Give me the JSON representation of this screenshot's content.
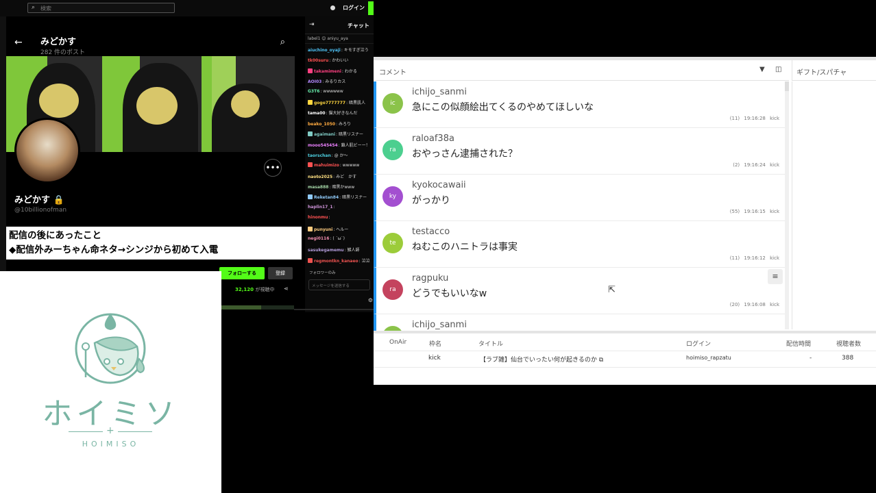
{
  "stream": {
    "search_placeholder": "検索",
    "login": "ログイン",
    "chat_title": "チャット",
    "pinned": "label1 😊 aniyu_aya",
    "follow_button": "フォローする",
    "subscribe_button": "登録",
    "viewers_count": "32,120",
    "viewers_label": "が視聴中",
    "progress_fraction": 0.55,
    "followers_label": "フォロワーのみ",
    "message_placeholder": "メッセージを送信する"
  },
  "profile": {
    "header_name": "みどかす",
    "post_count": "282 件のポスト",
    "display_name": "みどかす 🔒",
    "handle": "@10billionofman"
  },
  "caption": {
    "line1": "配信の後にあったこと",
    "line2": "◆配信外みーちゃん命ネタ→シンジから初めて入電"
  },
  "kick_chat": [
    {
      "user": "aiuchino_oyaji",
      "text": ": キモすぎ泣う",
      "color": "#4fc3f7"
    },
    {
      "user": "tk00suru",
      "text": ": かわいい",
      "color": "#ff5252"
    },
    {
      "user": "takamimeni",
      "text": ": わかる",
      "color": "#ff4081"
    },
    {
      "user": "AOI03",
      "text": ": みるりカス",
      "color": "#b388ff"
    },
    {
      "user": "G3T6",
      "text": ": wwwwww",
      "color": "#69f0ae"
    },
    {
      "user": "gogo7777777",
      "text": ": 暗黒肌人",
      "color": "#ffd740"
    },
    {
      "user": "tama00",
      "text": ": 猫大好きなんだ",
      "color": "#ffffff"
    },
    {
      "user": "beako_1050",
      "text": ": みろり",
      "color": "#ffab40"
    },
    {
      "user": "agaimani",
      "text": ": 暗黒リスナー",
      "color": "#80cbc4"
    },
    {
      "user": "mooo545454",
      "text": ": 鎖人肌ビーー！",
      "color": "#ea80fc"
    },
    {
      "user": "taorschan",
      "text": ": @ か〜",
      "color": "#4dd0e1"
    },
    {
      "user": "mahuimizo",
      "text": ": wwwww",
      "color": "#ff5252"
    },
    {
      "user": "naoto2025",
      "text": ": みど　かす",
      "color": "#ffe082"
    },
    {
      "user": "masa888",
      "text": ": 暗黒かwww",
      "color": "#a5d6a7"
    },
    {
      "user": "Reketan84",
      "text": ": 暗黒リスナー",
      "color": "#90caf9"
    },
    {
      "user": "haplin17_1",
      "text": ": ",
      "color": "#ce93d8"
    },
    {
      "user": "hinonmu",
      "text": ": ",
      "color": "#ff5252"
    },
    {
      "user": "punyuni",
      "text": ": へルー",
      "color": "#ffcc80"
    },
    {
      "user": "negi0116",
      "text": ": ( ´ω`)",
      "color": "#f48fb1"
    },
    {
      "user": "sasukegamemu",
      "text": ": 雑人師",
      "color": "#b39ddb"
    },
    {
      "user": "regmontkn_kanaeo",
      "text": ": 泣泣",
      "color": "#ef5350"
    }
  ],
  "comment_viewer": {
    "comments_label": "コメント",
    "gifts_label": "ギフト/スパチャ",
    "comments": [
      {
        "user": "ichijo_sanmi",
        "initials": "ic",
        "text": "急にこの似顔絵出てくるのやめてほしいな",
        "count": "(11)",
        "time": "19:16:28",
        "platform": "kick",
        "color": "#8bc34a"
      },
      {
        "user": "raloaf38a",
        "initials": "ra",
        "text": "おやっさん逮捕された？",
        "count": "(2)",
        "time": "19:16:24",
        "platform": "kick",
        "color": "#4ccf8f"
      },
      {
        "user": "kyokocawaii",
        "initials": "ky",
        "text": "がっかり",
        "count": "(55)",
        "time": "19:16:15",
        "platform": "kick",
        "color": "#a34fd0"
      },
      {
        "user": "testacco",
        "initials": "te",
        "text": "ねむこのハニトラは事実",
        "count": "(11)",
        "time": "19:16:12",
        "platform": "kick",
        "color": "#9ccc3a"
      },
      {
        "user": "ragpuku",
        "initials": "ra",
        "text": "どうでもいいなw",
        "count": "(20)",
        "time": "19:16:08",
        "platform": "kick",
        "color": "#c4435e"
      },
      {
        "user": "ichijo_sanmi",
        "initials": "ic",
        "text": "",
        "count": "",
        "time": "",
        "platform": "",
        "color": "#8bc34a"
      }
    ],
    "table": {
      "headers": {
        "onair": "OnAir",
        "frame": "枠名",
        "title": "タイトル",
        "login": "ログイン",
        "time": "配信時間",
        "viewers": "視聴者数"
      },
      "row": {
        "onair": "",
        "frame": "kick",
        "title": "【ラブ雑】仙台でいったい何が起きるのか",
        "login": "hoimiso_rapzatu",
        "time": "-",
        "viewers": "388"
      }
    }
  },
  "logo": {
    "text": "ホイミソ",
    "sub": "HOIMISO",
    "color": "#7ab5a4"
  }
}
